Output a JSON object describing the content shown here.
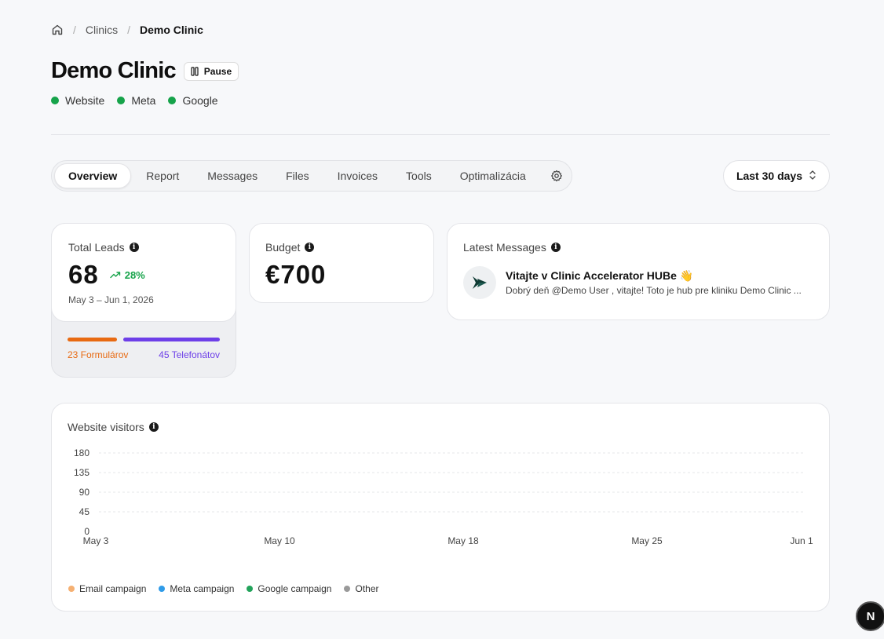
{
  "breadcrumb": {
    "items": [
      "Clinics",
      "Demo Clinic"
    ]
  },
  "header": {
    "title": "Demo Clinic",
    "pause_label": "Pause",
    "channels": [
      "Website",
      "Meta",
      "Google"
    ],
    "channel_color": "#16a34a"
  },
  "tabs": [
    "Overview",
    "Report",
    "Messages",
    "Files",
    "Invoices",
    "Tools",
    "Optimalizácia"
  ],
  "active_tab": "Overview",
  "date_range_select": "Last 30 days",
  "total_leads": {
    "label": "Total Leads",
    "value": "68",
    "trend": "28%",
    "date_range": "May 3 – Jun 1, 2026",
    "forms_label": "23 Formulárov",
    "calls_label": "45 Telefonátov",
    "forms_count": 23,
    "calls_count": 45,
    "forms_color": "#e86a12",
    "calls_color": "#6d3fe8"
  },
  "budget": {
    "label": "Budget",
    "value": "€700"
  },
  "latest_messages": {
    "label": "Latest Messages",
    "items": [
      {
        "title": "Vitajte v Clinic Accelerator HUBe 👋",
        "body": "Dobrý deň @Demo User , vitajte! Toto je hub pre kliniku Demo Clinic ..."
      }
    ]
  },
  "website_visitors": {
    "label": "Website visitors",
    "legend": [
      {
        "name": "Email campaign",
        "color": "#f5b072"
      },
      {
        "name": "Meta campaign",
        "color": "#2f9be8"
      },
      {
        "name": "Google campaign",
        "color": "#22a35a"
      },
      {
        "name": "Other",
        "color": "#9a9a9a"
      }
    ]
  },
  "chart_data": {
    "type": "line",
    "title": "Website visitors",
    "x_tick_labels": [
      "May 3",
      "May 10",
      "May 18",
      "May 25",
      "Jun 1"
    ],
    "y_tick_labels": [
      "180",
      "135",
      "90",
      "45",
      "0"
    ],
    "ylim": [
      0,
      180
    ],
    "grid": true,
    "legend_position": "bottom-left",
    "series": [
      {
        "name": "Email campaign",
        "values": []
      },
      {
        "name": "Meta campaign",
        "values": []
      },
      {
        "name": "Google campaign",
        "values": []
      },
      {
        "name": "Other",
        "values": []
      }
    ]
  },
  "next_badge": "N"
}
